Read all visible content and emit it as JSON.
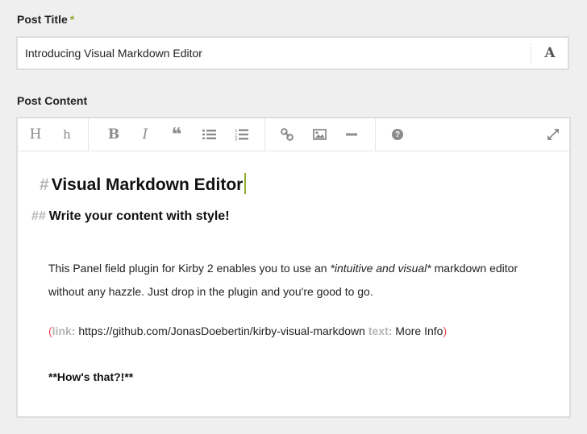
{
  "title_field": {
    "label": "Post Title",
    "required_mark": "*",
    "value": "Introducing Visual Markdown Editor",
    "icon": "font-icon",
    "icon_glyph": "A"
  },
  "content_field": {
    "label": "Post Content",
    "toolbar": {
      "items": [
        {
          "name": "heading-1",
          "glyph": "H"
        },
        {
          "name": "heading-2",
          "glyph": "h"
        },
        {
          "name": "bold",
          "glyph": "B"
        },
        {
          "name": "italic",
          "glyph": "I"
        },
        {
          "name": "blockquote",
          "glyph": "❝"
        },
        {
          "name": "unordered-list"
        },
        {
          "name": "ordered-list"
        },
        {
          "name": "link"
        },
        {
          "name": "image"
        },
        {
          "name": "horizontal-rule"
        },
        {
          "name": "help",
          "glyph": "?"
        },
        {
          "name": "fullscreen"
        }
      ]
    },
    "editor": {
      "h1": {
        "marker": "#",
        "text": "Visual Markdown Editor"
      },
      "h2": {
        "marker": "##",
        "text": "Write your content with style!"
      },
      "paragraph": {
        "before": "This Panel field plugin for Kirby 2 enables you to use an ",
        "emphasis": "*intuitive and visual*",
        "after": " markdown editor without any hazzle. Just drop in the plugin and you're good to go."
      },
      "link_tag": {
        "open": "(",
        "link_key": "link:",
        "url": "https://github.com/JonasDoebertin/kirby-visual-markdown",
        "text_key": "text:",
        "text": "More Info",
        "close": ")"
      },
      "strong_line": "**How's that?!**"
    }
  }
}
